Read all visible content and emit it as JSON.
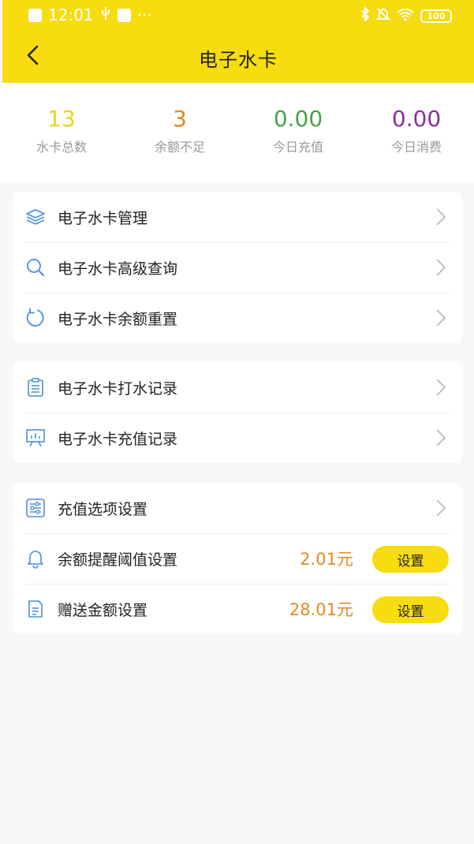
{
  "status": {
    "time": "12:01",
    "extra": "···",
    "battery": "100"
  },
  "nav": {
    "title": "电子水卡"
  },
  "stats": [
    {
      "value": "13",
      "label": "水卡总数",
      "color": "#e8d51e"
    },
    {
      "value": "3",
      "label": "余额不足",
      "color": "#e2861f"
    },
    {
      "value": "0.00",
      "label": "今日充值",
      "color": "#4aa14a"
    },
    {
      "value": "0.00",
      "label": "今日消费",
      "color": "#8e2ea0"
    }
  ],
  "group1": [
    {
      "label": "电子水卡管理",
      "icon": "layers-icon"
    },
    {
      "label": "电子水卡高级查询",
      "icon": "search-icon"
    },
    {
      "label": "电子水卡余额重置",
      "icon": "refresh-icon"
    }
  ],
  "group2": [
    {
      "label": "电子水卡打水记录",
      "icon": "clipboard-icon"
    },
    {
      "label": "电子水卡充值记录",
      "icon": "presentation-chart-icon"
    }
  ],
  "group3": {
    "options": {
      "label": "充值选项设置",
      "icon": "sliders-icon"
    },
    "threshold": {
      "label": "余额提醒阈值设置",
      "icon": "bell-icon",
      "amount": "2.01元",
      "button": "设置"
    },
    "bonus": {
      "label": "赠送金额设置",
      "icon": "document-icon",
      "amount": "28.01元",
      "button": "设置"
    }
  },
  "colors": {
    "brand": "#f7dc0f",
    "icon": "#4a8fd8",
    "amount": "#e38a1f"
  }
}
